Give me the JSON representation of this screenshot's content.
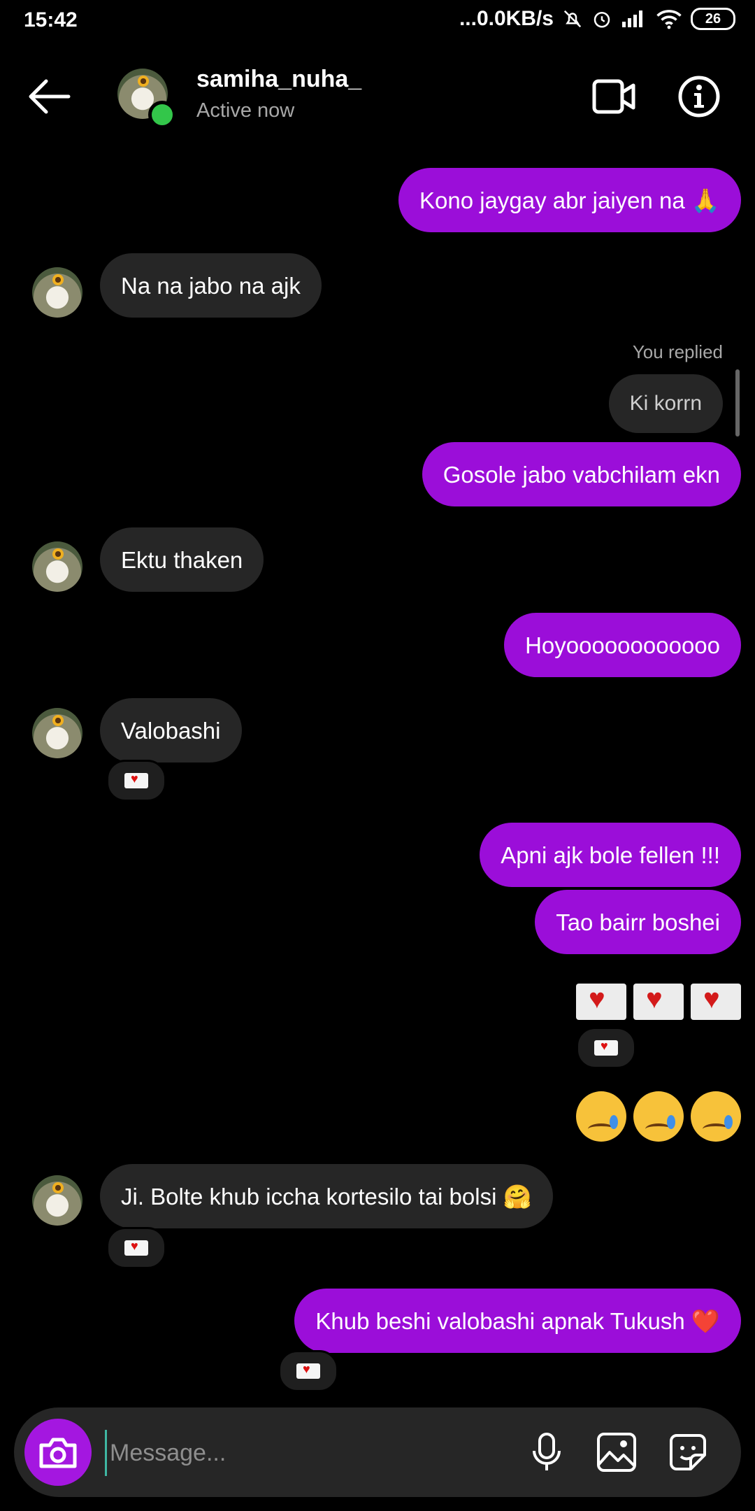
{
  "status_bar": {
    "time": "15:42",
    "network_speed": "...0.0KB/s",
    "battery": "26"
  },
  "header": {
    "username": "samiha_nuha_",
    "status": "Active now"
  },
  "messages": [
    {
      "side": "sent",
      "text": "Kono jaygay abr jaiyen na 🙏"
    },
    {
      "side": "recv",
      "text": "Na na jabo na ajk"
    },
    {
      "side": "reply_label",
      "text": "You replied"
    },
    {
      "side": "reply",
      "text": "Ki korrn"
    },
    {
      "side": "sent",
      "text": "Gosole jabo vabchilam ekn"
    },
    {
      "side": "recv",
      "text": "Ektu thaken"
    },
    {
      "side": "sent",
      "text": "Hoyoooooooooooo"
    },
    {
      "side": "recv",
      "text": "Valobashi",
      "reaction": "love-letter"
    },
    {
      "side": "sent",
      "text": "Apni ajk bole fellen !!!"
    },
    {
      "side": "sent",
      "text": "Tao bairr boshei"
    },
    {
      "side": "sent",
      "text": "💌💌💌",
      "reaction": "love-letter"
    },
    {
      "side": "sent",
      "text": "😢😢😢"
    },
    {
      "side": "recv",
      "text": "Ji. Bolte khub iccha kortesilo tai bolsi 🤗",
      "reaction": "love-letter"
    },
    {
      "side": "sent",
      "text": "Khub beshi valobashi apnak Tukush ❤️",
      "reaction": "love-letter"
    }
  ],
  "composer": {
    "placeholder": "Message..."
  },
  "colors": {
    "sent_bubble": "#9b0ed9",
    "received_bubble": "#262626",
    "online": "#33c64a",
    "camera_button": "#a417e0"
  },
  "icons": [
    "back-arrow-icon",
    "video-call-icon",
    "info-icon",
    "camera-icon",
    "microphone-icon",
    "gallery-icon",
    "sticker-icon",
    "love-letter-icon",
    "crying-face-icon"
  ]
}
